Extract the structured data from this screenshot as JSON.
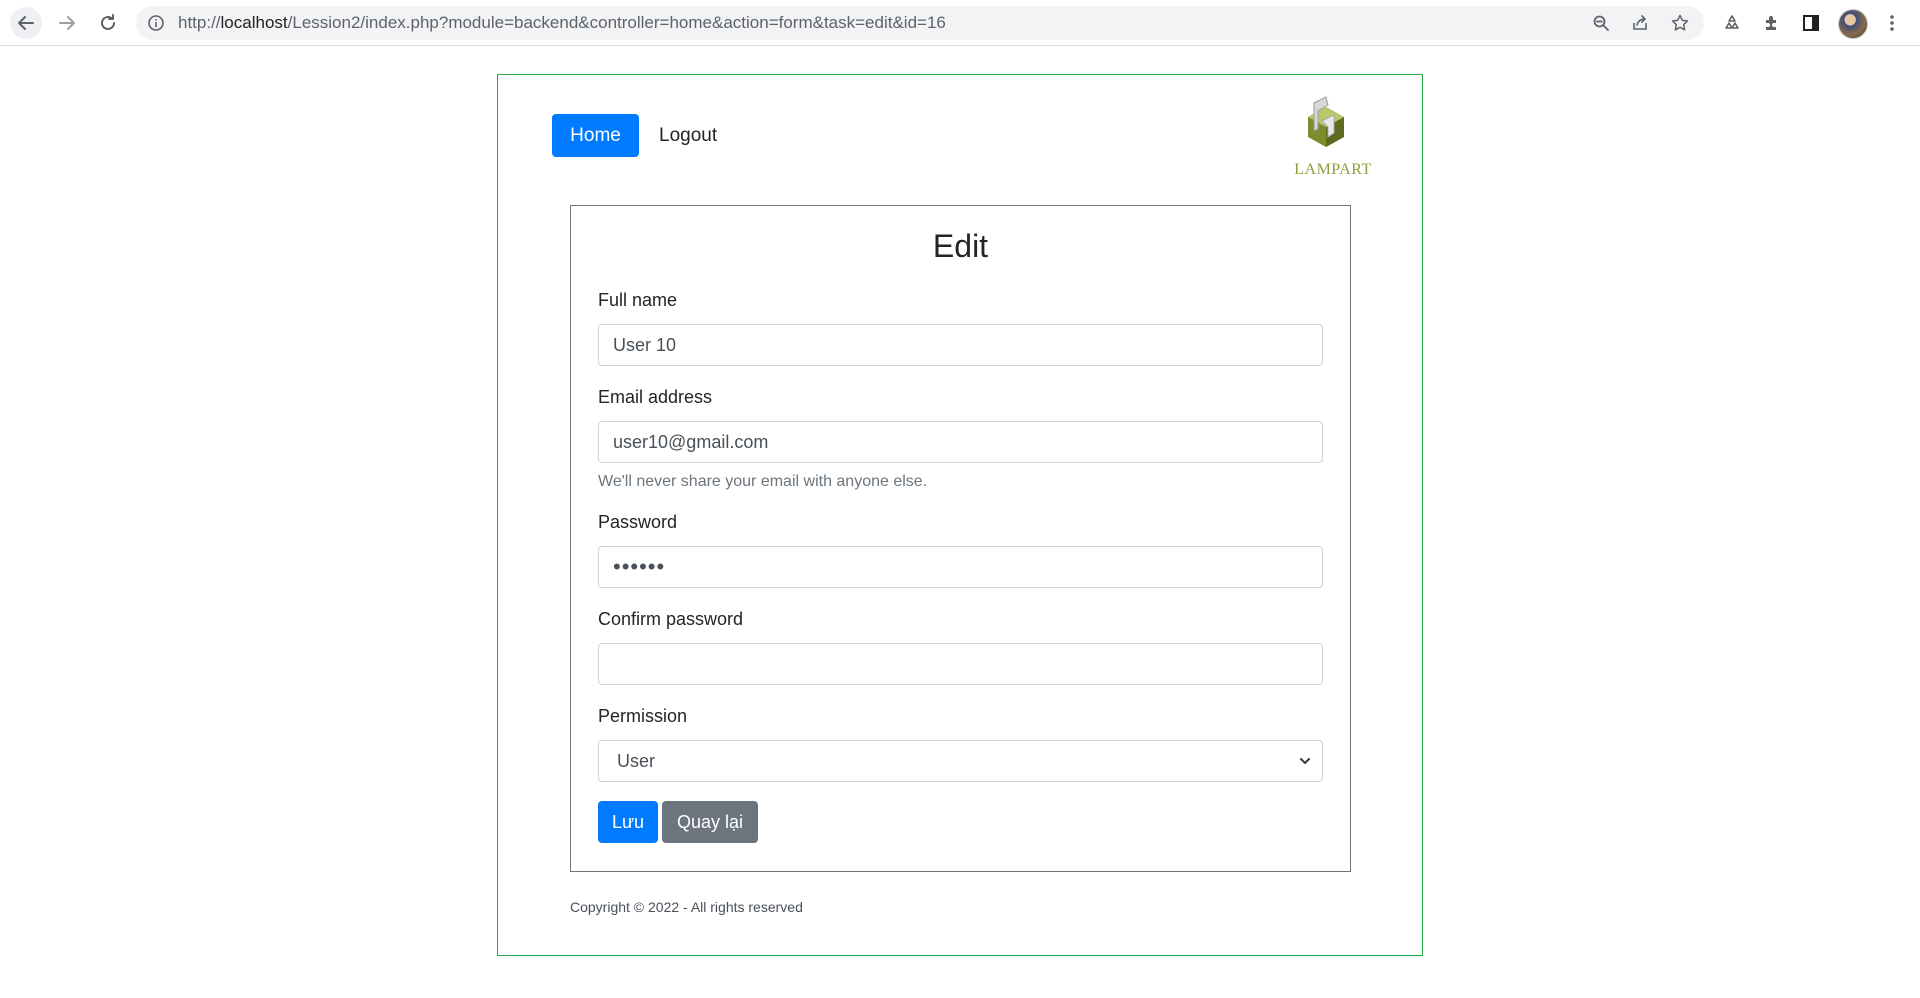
{
  "browser": {
    "url_scheme": "http://",
    "url_host": "localhost",
    "url_path": "/Lession2/index.php?module=backend&controller=home&action=form&task=edit&id=16"
  },
  "nav": {
    "home_label": "Home",
    "logout_label": "Logout",
    "logo_text": "LAMPART"
  },
  "form": {
    "title": "Edit",
    "fullname_label": "Full name",
    "fullname_value": "User 10",
    "email_label": "Email address",
    "email_value": "user10@gmail.com",
    "email_help": "We'll never share your email with anyone else.",
    "password_label": "Password",
    "password_value": "••••••",
    "confirm_label": "Confirm password",
    "confirm_value": "",
    "permission_label": "Permission",
    "permission_selected": "User",
    "save_label": "Lưu",
    "back_label": "Quay lại"
  },
  "footer": {
    "copyright": "Copyright © 2022 - All rights reserved"
  },
  "colors": {
    "primary": "#007bff",
    "secondary": "#6c757d",
    "page_border": "#28a745",
    "logo_green": "#8aa03c"
  }
}
